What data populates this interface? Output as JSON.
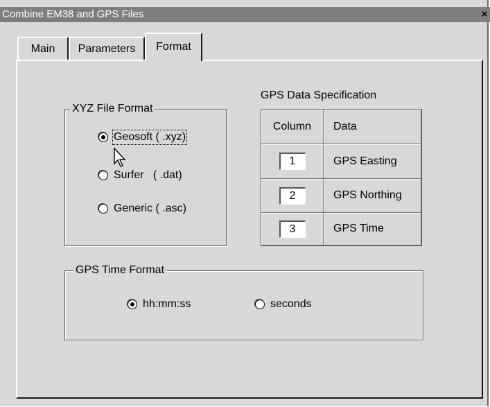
{
  "window": {
    "title": "Combine EM38 and GPS Files",
    "close_glyph": "×"
  },
  "tabs": [
    {
      "label": "Main",
      "active": false
    },
    {
      "label": "Parameters",
      "active": false
    },
    {
      "label": "Format",
      "active": true
    }
  ],
  "xyz_format": {
    "title": "XYZ File Format",
    "options": [
      {
        "label": "Geosoft ( .xyz)",
        "selected": true
      },
      {
        "label": "Surfer   ( .dat)",
        "selected": false
      },
      {
        "label": "Generic ( .asc)",
        "selected": false
      }
    ]
  },
  "gps_spec": {
    "title": "GPS Data Specification",
    "headers": [
      "Column",
      "Data"
    ],
    "rows": [
      {
        "column": "1",
        "data": "GPS Easting"
      },
      {
        "column": "2",
        "data": "GPS Northing"
      },
      {
        "column": "3",
        "data": "GPS Time"
      }
    ]
  },
  "time_format": {
    "title": "GPS Time Format",
    "options": [
      {
        "label": "hh:mm:ss",
        "selected": true
      },
      {
        "label": "seconds",
        "selected": false
      }
    ]
  }
}
